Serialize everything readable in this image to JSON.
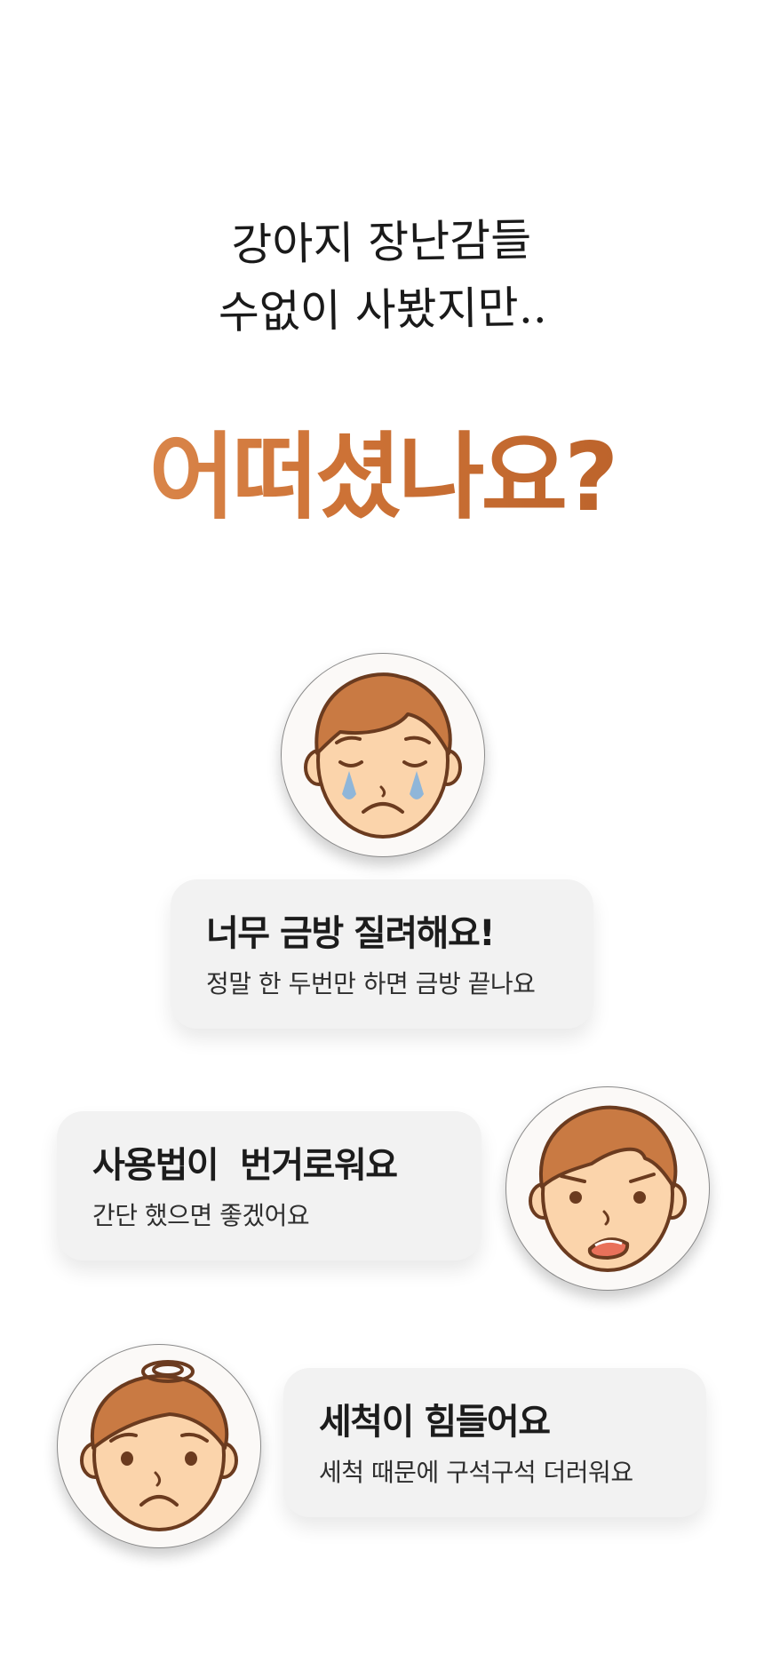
{
  "intro": {
    "line1": "강아지 장난감들",
    "line2": "수없이 사봤지만.."
  },
  "headline": "어떠셨나요?",
  "reviews": [
    {
      "title": "너무 금방 질려해요!",
      "subtitle": "정말 한 두번만 하면 금방 끝나요",
      "face": "crying-face-icon"
    },
    {
      "title": "사용법이  번거로워요",
      "subtitle": "간단 했으면 좋겠어요",
      "face": "annoyed-face-icon"
    },
    {
      "title": "세척이 힘들어요",
      "subtitle": "세척 때문에 구석구석 더러워요",
      "face": "frustrated-face-icon"
    }
  ],
  "colors": {
    "headline_gradient": [
      "#e39459",
      "#cd7236",
      "#b45c26"
    ],
    "card_background": "#f2f2f2",
    "hair": "#c97a43",
    "skin": "#fbd4ab",
    "outline": "#6b3b1f",
    "tear": "#8fb6d9"
  }
}
